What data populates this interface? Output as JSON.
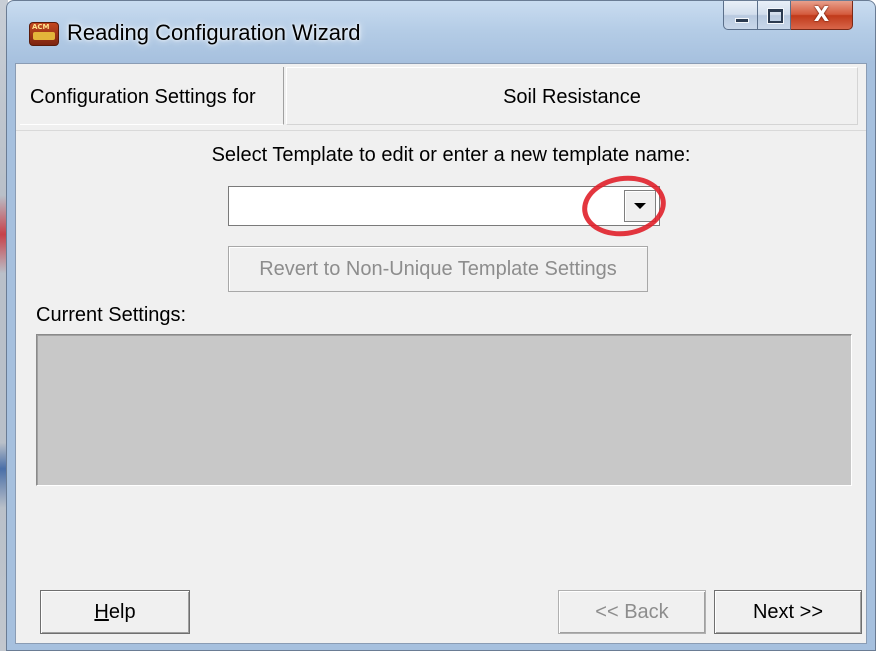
{
  "window": {
    "title": "Reading Configuration Wizard",
    "icon": "app-logo-icon",
    "app_icon_text": "ACM",
    "caption_buttons": {
      "minimize": "minimize-icon",
      "maximize": "maximize-icon",
      "close": "close-icon",
      "close_glyph": "X"
    }
  },
  "header": {
    "label": "Configuration Settings for",
    "value": "Soil Resistance"
  },
  "template": {
    "prompt": "Select Template to edit or enter a new template name:",
    "combo_value": "",
    "dropdown_icon": "chevron-down-icon"
  },
  "revert_button": {
    "label": "Revert to Non-Unique Template Settings",
    "enabled": false
  },
  "current_settings": {
    "label": "Current Settings:",
    "content": ""
  },
  "footer": {
    "help": {
      "mnemonic": "H",
      "rest": "elp"
    },
    "back": {
      "label": "<< Back",
      "enabled": false
    },
    "next": {
      "label": "Next >>",
      "enabled": true
    }
  },
  "colors": {
    "annotation_ring": "#e0202a",
    "dialog_background": "#f0f0f0",
    "settings_area": "#c8c8c8",
    "disabled_text": "#8d8d8d"
  }
}
